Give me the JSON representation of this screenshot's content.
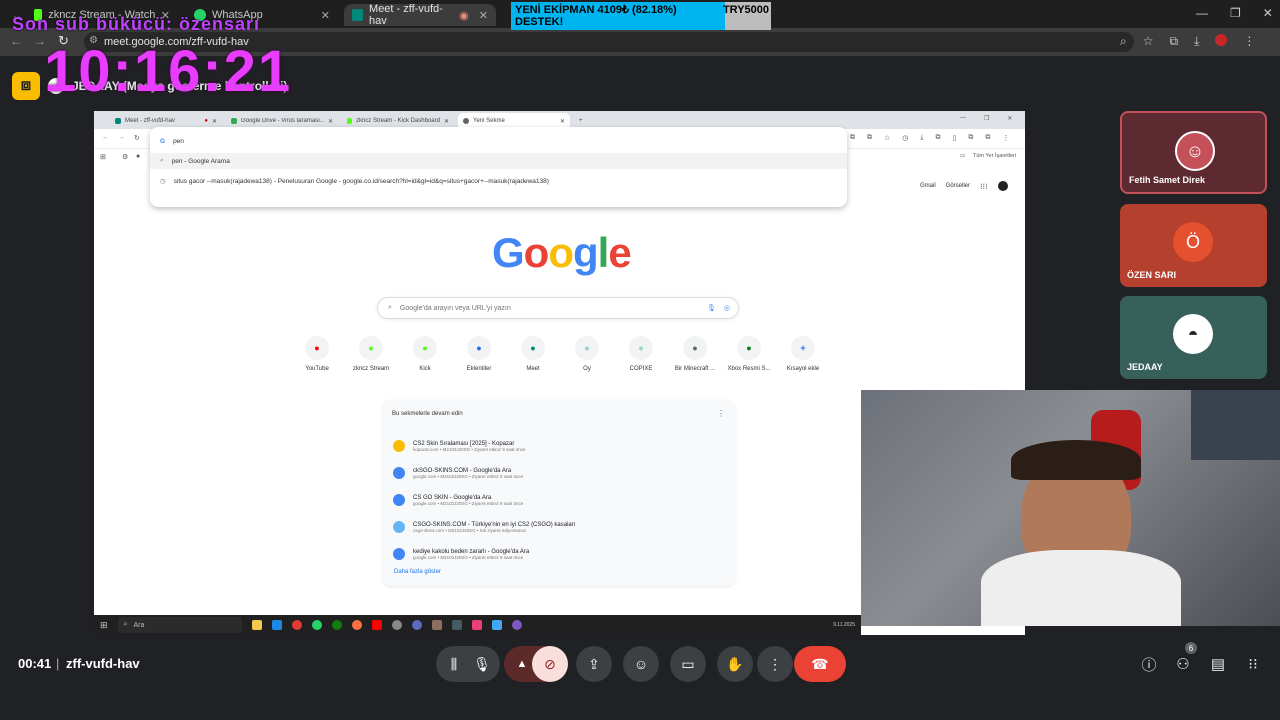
{
  "browser": {
    "tabs": [
      {
        "label": "zkncz Stream - Watch Live on K",
        "active": false
      },
      {
        "label": "WhatsApp",
        "active": false
      },
      {
        "label": "Meet - zff-vufd-hav",
        "active": true
      }
    ],
    "url": "meet.google.com/zff-vufd-hav"
  },
  "overlay": {
    "sub_text": "Son sub bükücü: özensarı",
    "clock": "10:16:21",
    "donation_line1": "YENİ EKİPMAN 4109₺ (82.18%)",
    "donation_line2": "DESTEK!",
    "donation_amount": "TRY5000",
    "donation_progress": 0.8218
  },
  "meet": {
    "presenter_label": "JEDAAY (Medya gösterme kontrolleri)",
    "time": "00:41",
    "code": "zff-vufd-hav",
    "participant_count": "6",
    "participants": [
      {
        "name": "Fetih Samet Direk",
        "initial": ""
      },
      {
        "name": "ÖZEN SARI",
        "initial": "Ö"
      },
      {
        "name": "JEDAAY",
        "initial": ""
      }
    ]
  },
  "shared": {
    "tabs": [
      {
        "label": "Meet - zff-vufd-hav"
      },
      {
        "label": "Google Drive - Virüs taraması..."
      },
      {
        "label": "zkncz Stream - Kick Dashboard"
      },
      {
        "label": "Yeni Sekme"
      }
    ],
    "omnibox_value": "pen",
    "suggestions": [
      {
        "text": "pen - Google Arama"
      },
      {
        "text": "situs gacor --masuk(rajadewa138) - Penelusuran Google - google.co.id/search?hl=id&gl=id&q=situs+gacor+--masuk(rajadewa138)"
      }
    ],
    "all_bookmarks": "Tüm Yer İşaretleri",
    "google_links": {
      "gmail": "Gmail",
      "images": "Görseller"
    },
    "google_logo": "Google",
    "search_placeholder": "Google'da arayın veya URL'yi yazın",
    "shortcuts": [
      {
        "label": "YouTube",
        "color": "#ff0000"
      },
      {
        "label": "zkncz Stream",
        "color": "#53fc18"
      },
      {
        "label": "Kick",
        "color": "#53fc18"
      },
      {
        "label": "Eklentiler",
        "color": "#1a73e8"
      },
      {
        "label": "Meet",
        "color": "#00897b"
      },
      {
        "label": "Oy",
        "color": "#9bd0c0"
      },
      {
        "label": "COPIXE",
        "color": "#9bd0c0"
      },
      {
        "label": "Bir Minecraft ...",
        "color": "#666666"
      },
      {
        "label": "Xbox Resmi S...",
        "color": "#107c10"
      },
      {
        "label": "Kısayol ekle",
        "color": "#1a73e8"
      }
    ],
    "continue_title": "Bu sekmelerle devam edin",
    "continue_items": [
      {
        "title": "CS2 Skin Sıralaması [2025] - Kopazar",
        "sub": "kopazar.com • M2102J20SG • Ziyaret ettiniz 9 saat önce"
      },
      {
        "title": "ckSGO-SKINS.COM - Google'da Ara",
        "sub": "google.com • M2102J20SG • Ziyaret ettiniz 9 saat önce"
      },
      {
        "title": "CS GO SKIN - Google'da Ara",
        "sub": "google.com • M2102J20SG • Ziyaret ettiniz 9 saat önce"
      },
      {
        "title": "CSGO-SKINS.COM - Türkiye'nin en iyi CS2 (CSGO) kasaları",
        "sub": "csgo-skins.com • M2102J20SG • Sık ziyaret ediyorsunuz"
      },
      {
        "title": "kediye kakolu beden zararlı - Google'da Ara",
        "sub": "google.com • M2102J20SG • Ziyaret ettiniz 9 saat önce"
      }
    ],
    "show_more": "Daha fazla göster",
    "taskbar_search": "Ara",
    "taskbar_date": "9.11.2025"
  }
}
